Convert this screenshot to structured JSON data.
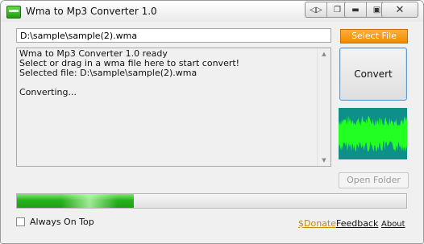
{
  "window": {
    "title": "Wma to Mp3 Converter 1.0",
    "icons": [
      "app-icon",
      "audio-icon",
      "restore-icon",
      "minimize-icon",
      "maximize-icon",
      "close-icon"
    ]
  },
  "file": {
    "path": "D:\\sample\\sample(2).wma",
    "select_label": "Select File"
  },
  "log": {
    "lines": [
      "Wma to Mp3 Converter 1.0 ready",
      "Select or drag in a wma file here to start convert!",
      "Selected file: D:\\sample\\sample(2).wma",
      "",
      "Converting..."
    ]
  },
  "actions": {
    "convert_label": "Convert",
    "open_folder_label": "Open Folder"
  },
  "progress": {
    "value": 0.3
  },
  "footer": {
    "always_on_top_label": "Always On Top",
    "always_on_top_checked": false,
    "donate_label": "$Donate",
    "feedback_label": "Feedback",
    "about_label": "About"
  },
  "colors": {
    "select_button": "#f08a00",
    "progress_green": "#27b21c",
    "waveform_bg": "#0f8f8a",
    "waveform_fg": "#22ff22",
    "donate_link": "#c58a00"
  }
}
